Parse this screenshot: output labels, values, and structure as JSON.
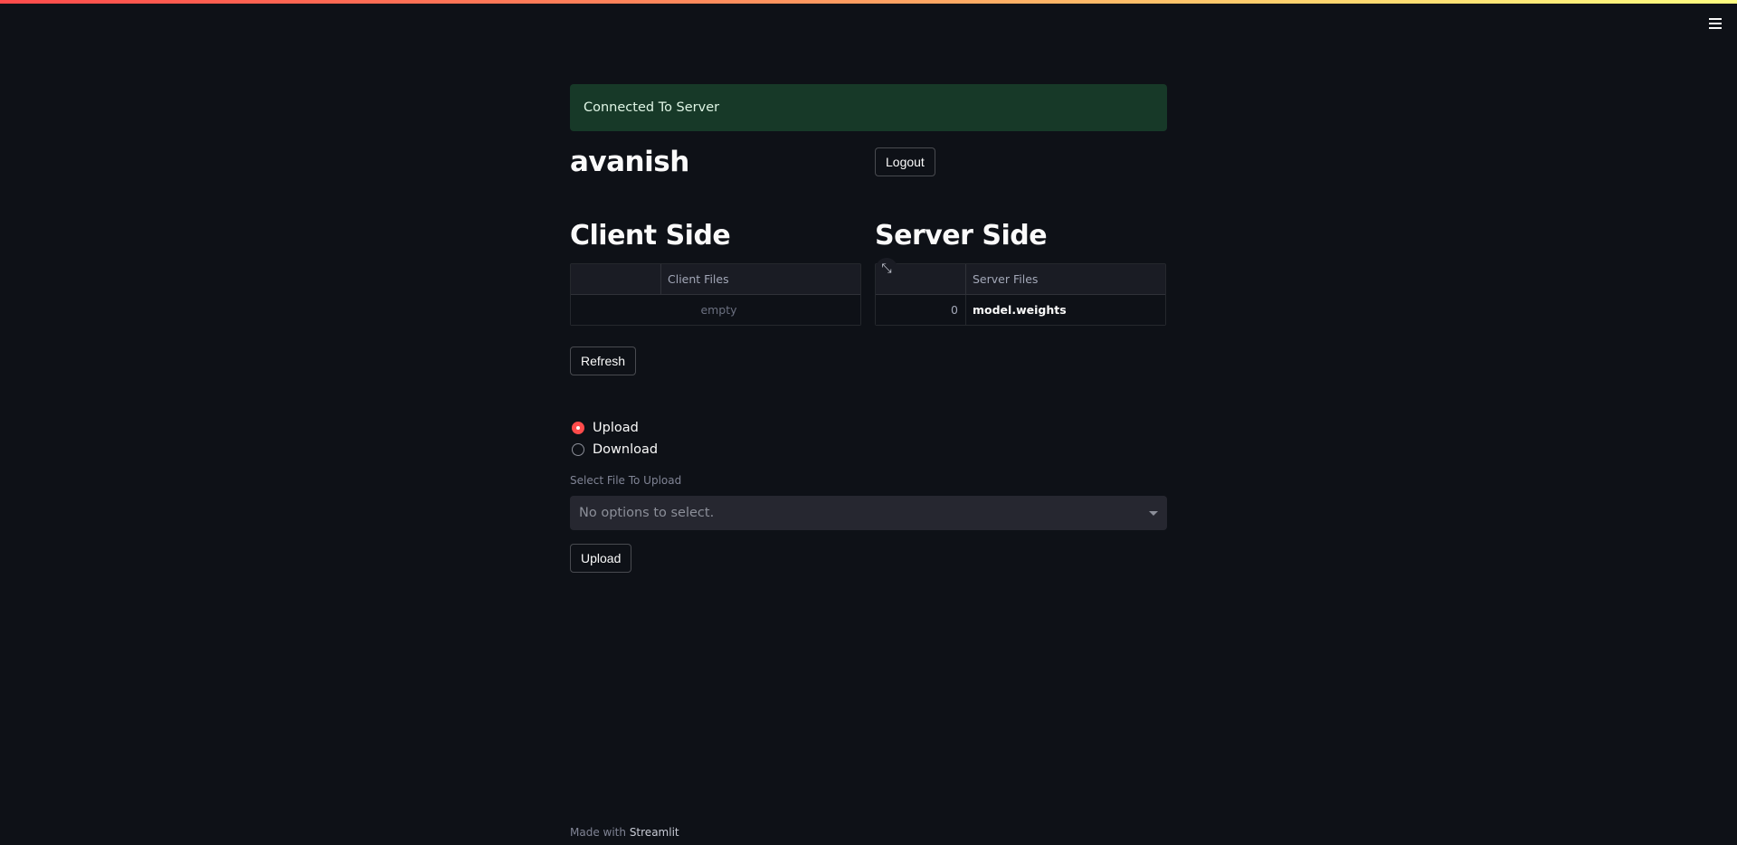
{
  "alert": {
    "message": "Connected To Server"
  },
  "user": {
    "name": "avanish",
    "logout_label": "Logout"
  },
  "client": {
    "title": "Client Side",
    "table": {
      "column": "Client Files",
      "empty_text": "empty"
    }
  },
  "server": {
    "title": "Server Side",
    "table": {
      "column": "Server Files",
      "rows": [
        {
          "index": "0",
          "value": "model.weights"
        }
      ]
    }
  },
  "refresh_label": "Refresh",
  "mode": {
    "options": [
      "Upload",
      "Download"
    ],
    "selected": "Upload"
  },
  "file_select": {
    "label": "Select File To Upload",
    "placeholder": "No options to select."
  },
  "upload_label": "Upload",
  "footer": {
    "prefix": "Made with",
    "brand": "Streamlit"
  },
  "icons": {
    "menu": "hamburger-icon",
    "expand": "expand-icon",
    "caret": "chevron-down-icon"
  },
  "colors": {
    "accent": "#ff4b4b",
    "background": "#0e1117",
    "success_bg": "#173928"
  }
}
